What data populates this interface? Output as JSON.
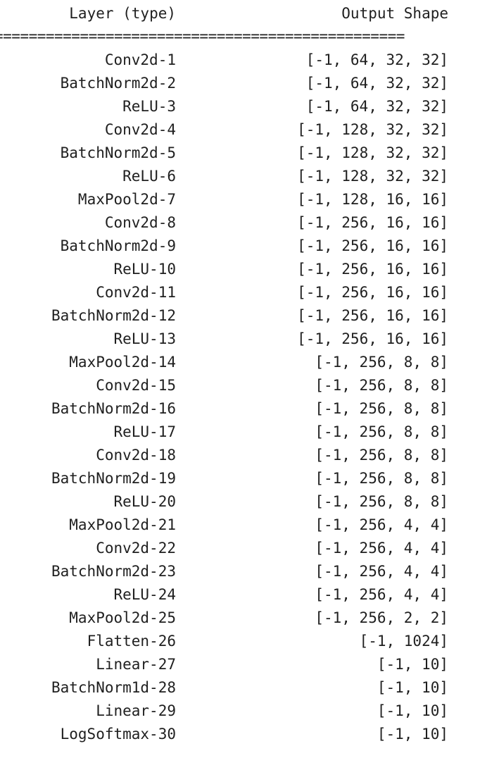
{
  "header": {
    "layer_col": "Layer (type)",
    "shape_col": "Output Shape",
    "separator": "================================================"
  },
  "rows": [
    {
      "layer": "Conv2d-1",
      "shape": "[-1, 64, 32, 32]"
    },
    {
      "layer": "BatchNorm2d-2",
      "shape": "[-1, 64, 32, 32]"
    },
    {
      "layer": "ReLU-3",
      "shape": "[-1, 64, 32, 32]"
    },
    {
      "layer": "Conv2d-4",
      "shape": "[-1, 128, 32, 32]"
    },
    {
      "layer": "BatchNorm2d-5",
      "shape": "[-1, 128, 32, 32]"
    },
    {
      "layer": "ReLU-6",
      "shape": "[-1, 128, 32, 32]"
    },
    {
      "layer": "MaxPool2d-7",
      "shape": "[-1, 128, 16, 16]"
    },
    {
      "layer": "Conv2d-8",
      "shape": "[-1, 256, 16, 16]"
    },
    {
      "layer": "BatchNorm2d-9",
      "shape": "[-1, 256, 16, 16]"
    },
    {
      "layer": "ReLU-10",
      "shape": "[-1, 256, 16, 16]"
    },
    {
      "layer": "Conv2d-11",
      "shape": "[-1, 256, 16, 16]"
    },
    {
      "layer": "BatchNorm2d-12",
      "shape": "[-1, 256, 16, 16]"
    },
    {
      "layer": "ReLU-13",
      "shape": "[-1, 256, 16, 16]"
    },
    {
      "layer": "MaxPool2d-14",
      "shape": "[-1, 256, 8, 8]"
    },
    {
      "layer": "Conv2d-15",
      "shape": "[-1, 256, 8, 8]"
    },
    {
      "layer": "BatchNorm2d-16",
      "shape": "[-1, 256, 8, 8]"
    },
    {
      "layer": "ReLU-17",
      "shape": "[-1, 256, 8, 8]"
    },
    {
      "layer": "Conv2d-18",
      "shape": "[-1, 256, 8, 8]"
    },
    {
      "layer": "BatchNorm2d-19",
      "shape": "[-1, 256, 8, 8]"
    },
    {
      "layer": "ReLU-20",
      "shape": "[-1, 256, 8, 8]"
    },
    {
      "layer": "MaxPool2d-21",
      "shape": "[-1, 256, 4, 4]"
    },
    {
      "layer": "Conv2d-22",
      "shape": "[-1, 256, 4, 4]"
    },
    {
      "layer": "BatchNorm2d-23",
      "shape": "[-1, 256, 4, 4]"
    },
    {
      "layer": "ReLU-24",
      "shape": "[-1, 256, 4, 4]"
    },
    {
      "layer": "MaxPool2d-25",
      "shape": "[-1, 256, 2, 2]"
    },
    {
      "layer": "Flatten-26",
      "shape": "[-1, 1024]"
    },
    {
      "layer": "Linear-27",
      "shape": "[-1, 10]"
    },
    {
      "layer": "BatchNorm1d-28",
      "shape": "[-1, 10]"
    },
    {
      "layer": "Linear-29",
      "shape": "[-1, 10]"
    },
    {
      "layer": "LogSoftmax-30",
      "shape": "[-1, 10]"
    }
  ]
}
